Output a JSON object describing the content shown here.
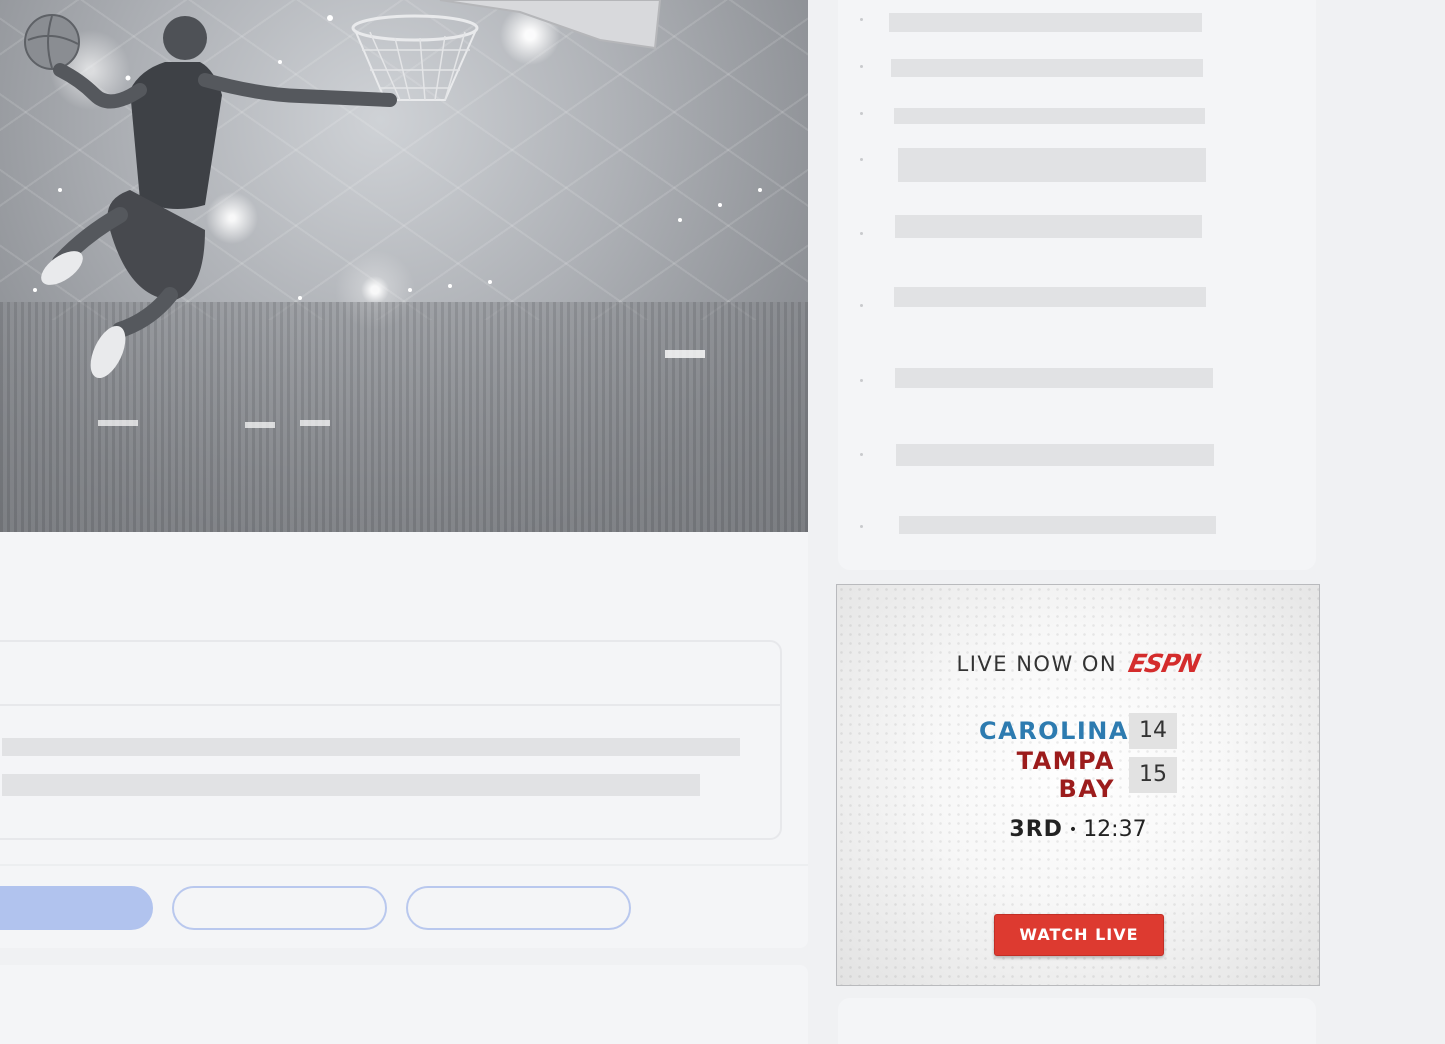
{
  "hero": {
    "image_description_icon": "basketball-dunk-photo-icon"
  },
  "ad": {
    "live_label": "LIVE NOW ON",
    "network_logo": "ESPN",
    "teams": [
      {
        "name": "CAROLINA",
        "score": "14",
        "color": "#2d7bb0"
      },
      {
        "name": "TAMPA BAY",
        "score": "15",
        "color": "#9c1c1c"
      }
    ],
    "period": "3RD",
    "separator": "•",
    "time": "12:37",
    "watch_button_label": "WATCH LIVE",
    "button_color": "#dd3a30"
  },
  "colors": {
    "page_background": "#f0f1f3",
    "card_background": "#f4f5f7",
    "skeleton": "#e1e2e4",
    "pill_active": "#b1c3ee",
    "pill_border": "#b9c8ee"
  }
}
